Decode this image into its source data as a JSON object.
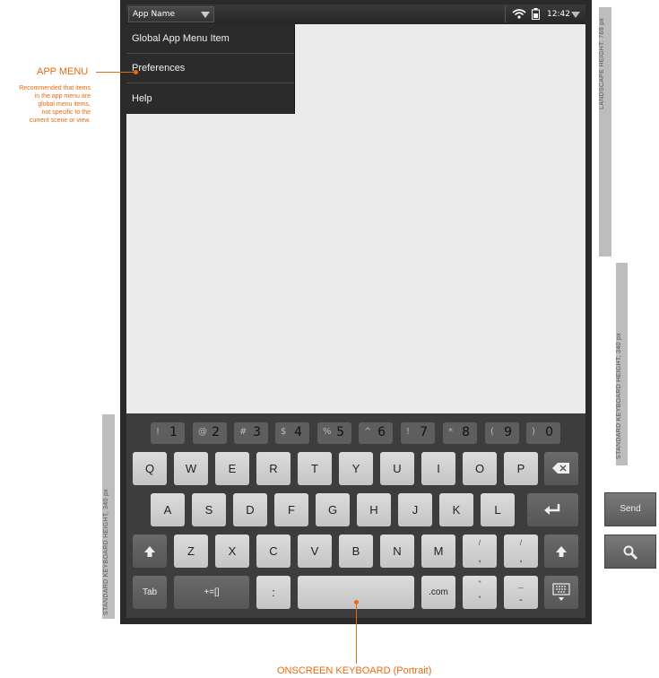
{
  "status_bar": {
    "app_name": "App Name",
    "clock": "12:42"
  },
  "app_menu": {
    "items": [
      "Global App Menu Item",
      "Preferences",
      "Help"
    ]
  },
  "keyboard": {
    "number_row": [
      {
        "sym": "!",
        "num": "1"
      },
      {
        "sym": "@",
        "num": "2"
      },
      {
        "sym": "#",
        "num": "3"
      },
      {
        "sym": "$",
        "num": "4"
      },
      {
        "sym": "%",
        "num": "5"
      },
      {
        "sym": "^",
        "num": "6"
      },
      {
        "sym": "!",
        "num": "7"
      },
      {
        "sym": "*",
        "num": "8"
      },
      {
        "sym": "(",
        "num": "9"
      },
      {
        "sym": ")",
        "num": "0"
      }
    ],
    "row1": [
      "Q",
      "W",
      "E",
      "R",
      "T",
      "Y",
      "U",
      "I",
      "O",
      "P"
    ],
    "row2": [
      "A",
      "S",
      "D",
      "F",
      "G",
      "H",
      "J",
      "K",
      "L"
    ],
    "row3": [
      "Z",
      "X",
      "C",
      "V",
      "B",
      "N",
      "M"
    ],
    "row3_extra": [
      {
        "top": "/",
        "bottom": ","
      },
      {
        "top": "/",
        "bottom": ","
      }
    ],
    "row4": {
      "tab": "Tab",
      "symbols": "+=[]",
      "colon": ":",
      "dotcom": ".com",
      "key5_top": "\"",
      "key5_bottom": "'",
      "key6_top": "_",
      "key6_bottom": "-"
    }
  },
  "side_buttons": {
    "send": "Send"
  },
  "annotations": {
    "app_menu_title": "APP MENU",
    "app_menu_note": [
      "Recommended that items",
      "in the app menu are",
      "global menu items,",
      "not specific to the",
      "current scene or view."
    ],
    "keyboard_title": "ONSCREEN KEYBOARD (Portrait)",
    "landscape_height": "LANDSCAPE HEIGHT: 768 px",
    "keyboard_height_right": "STANDARD KEYBOARD HEIGHT, 340 px",
    "keyboard_height_left": "STANDARD KEYBOARD HEIGHT, 340 px"
  },
  "icons": {
    "wifi": "wifi-icon",
    "battery": "battery-icon",
    "backspace": "backspace-icon",
    "enter": "enter-icon",
    "shift": "shift-icon",
    "keyboard": "keyboard-icon",
    "search": "search-icon"
  },
  "colors": {
    "accent": "#e86a10",
    "frame": "#2a2a2a",
    "screen": "#ebebeb"
  }
}
